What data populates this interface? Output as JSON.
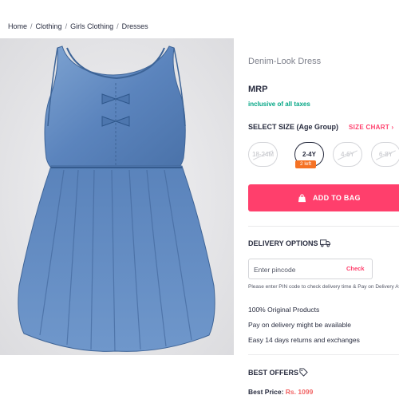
{
  "breadcrumb": {
    "items": [
      "Home",
      "Clothing",
      "Girls Clothing",
      "Dresses"
    ],
    "separator": "/"
  },
  "product": {
    "title": "Denim-Look Dress",
    "mrp_label": "MRP",
    "tax_note": "inclusive of all taxes",
    "image_icon": "denim-dress-image"
  },
  "sizes": {
    "heading": "SELECT SIZE (Age Group)",
    "chart_label": "SIZE CHART",
    "chart_icon": "chevron-right-icon",
    "options": [
      {
        "label": "18-24M",
        "available": false,
        "selected": false
      },
      {
        "label": "2-4Y",
        "available": true,
        "selected": true
      },
      {
        "label": "4-6Y",
        "available": false,
        "selected": false
      },
      {
        "label": "6-8Y",
        "available": false,
        "selected": false
      }
    ],
    "stock_badge": "2 left"
  },
  "cart": {
    "add_to_bag": "ADD TO BAG",
    "icon": "bag-icon"
  },
  "delivery": {
    "heading": "DELIVERY OPTIONS",
    "icon": "truck-icon",
    "pincode_placeholder": "Enter pincode",
    "check_label": "Check",
    "note": "Please enter PIN code to check delivery time & Pay on Delivery Availability"
  },
  "features": [
    "100% Original Products",
    "Pay on delivery might be available",
    "Easy 14 days returns and exchanges"
  ],
  "offers": {
    "heading": "BEST OFFERS",
    "icon": "tag-icon",
    "best_price_label": "Best Price:",
    "best_price_value": "Rs. 1099"
  },
  "colors": {
    "accent": "#ff3f6c",
    "tax_green": "#03a685",
    "stock_orange": "#f57224",
    "price_red": "#f16565"
  }
}
